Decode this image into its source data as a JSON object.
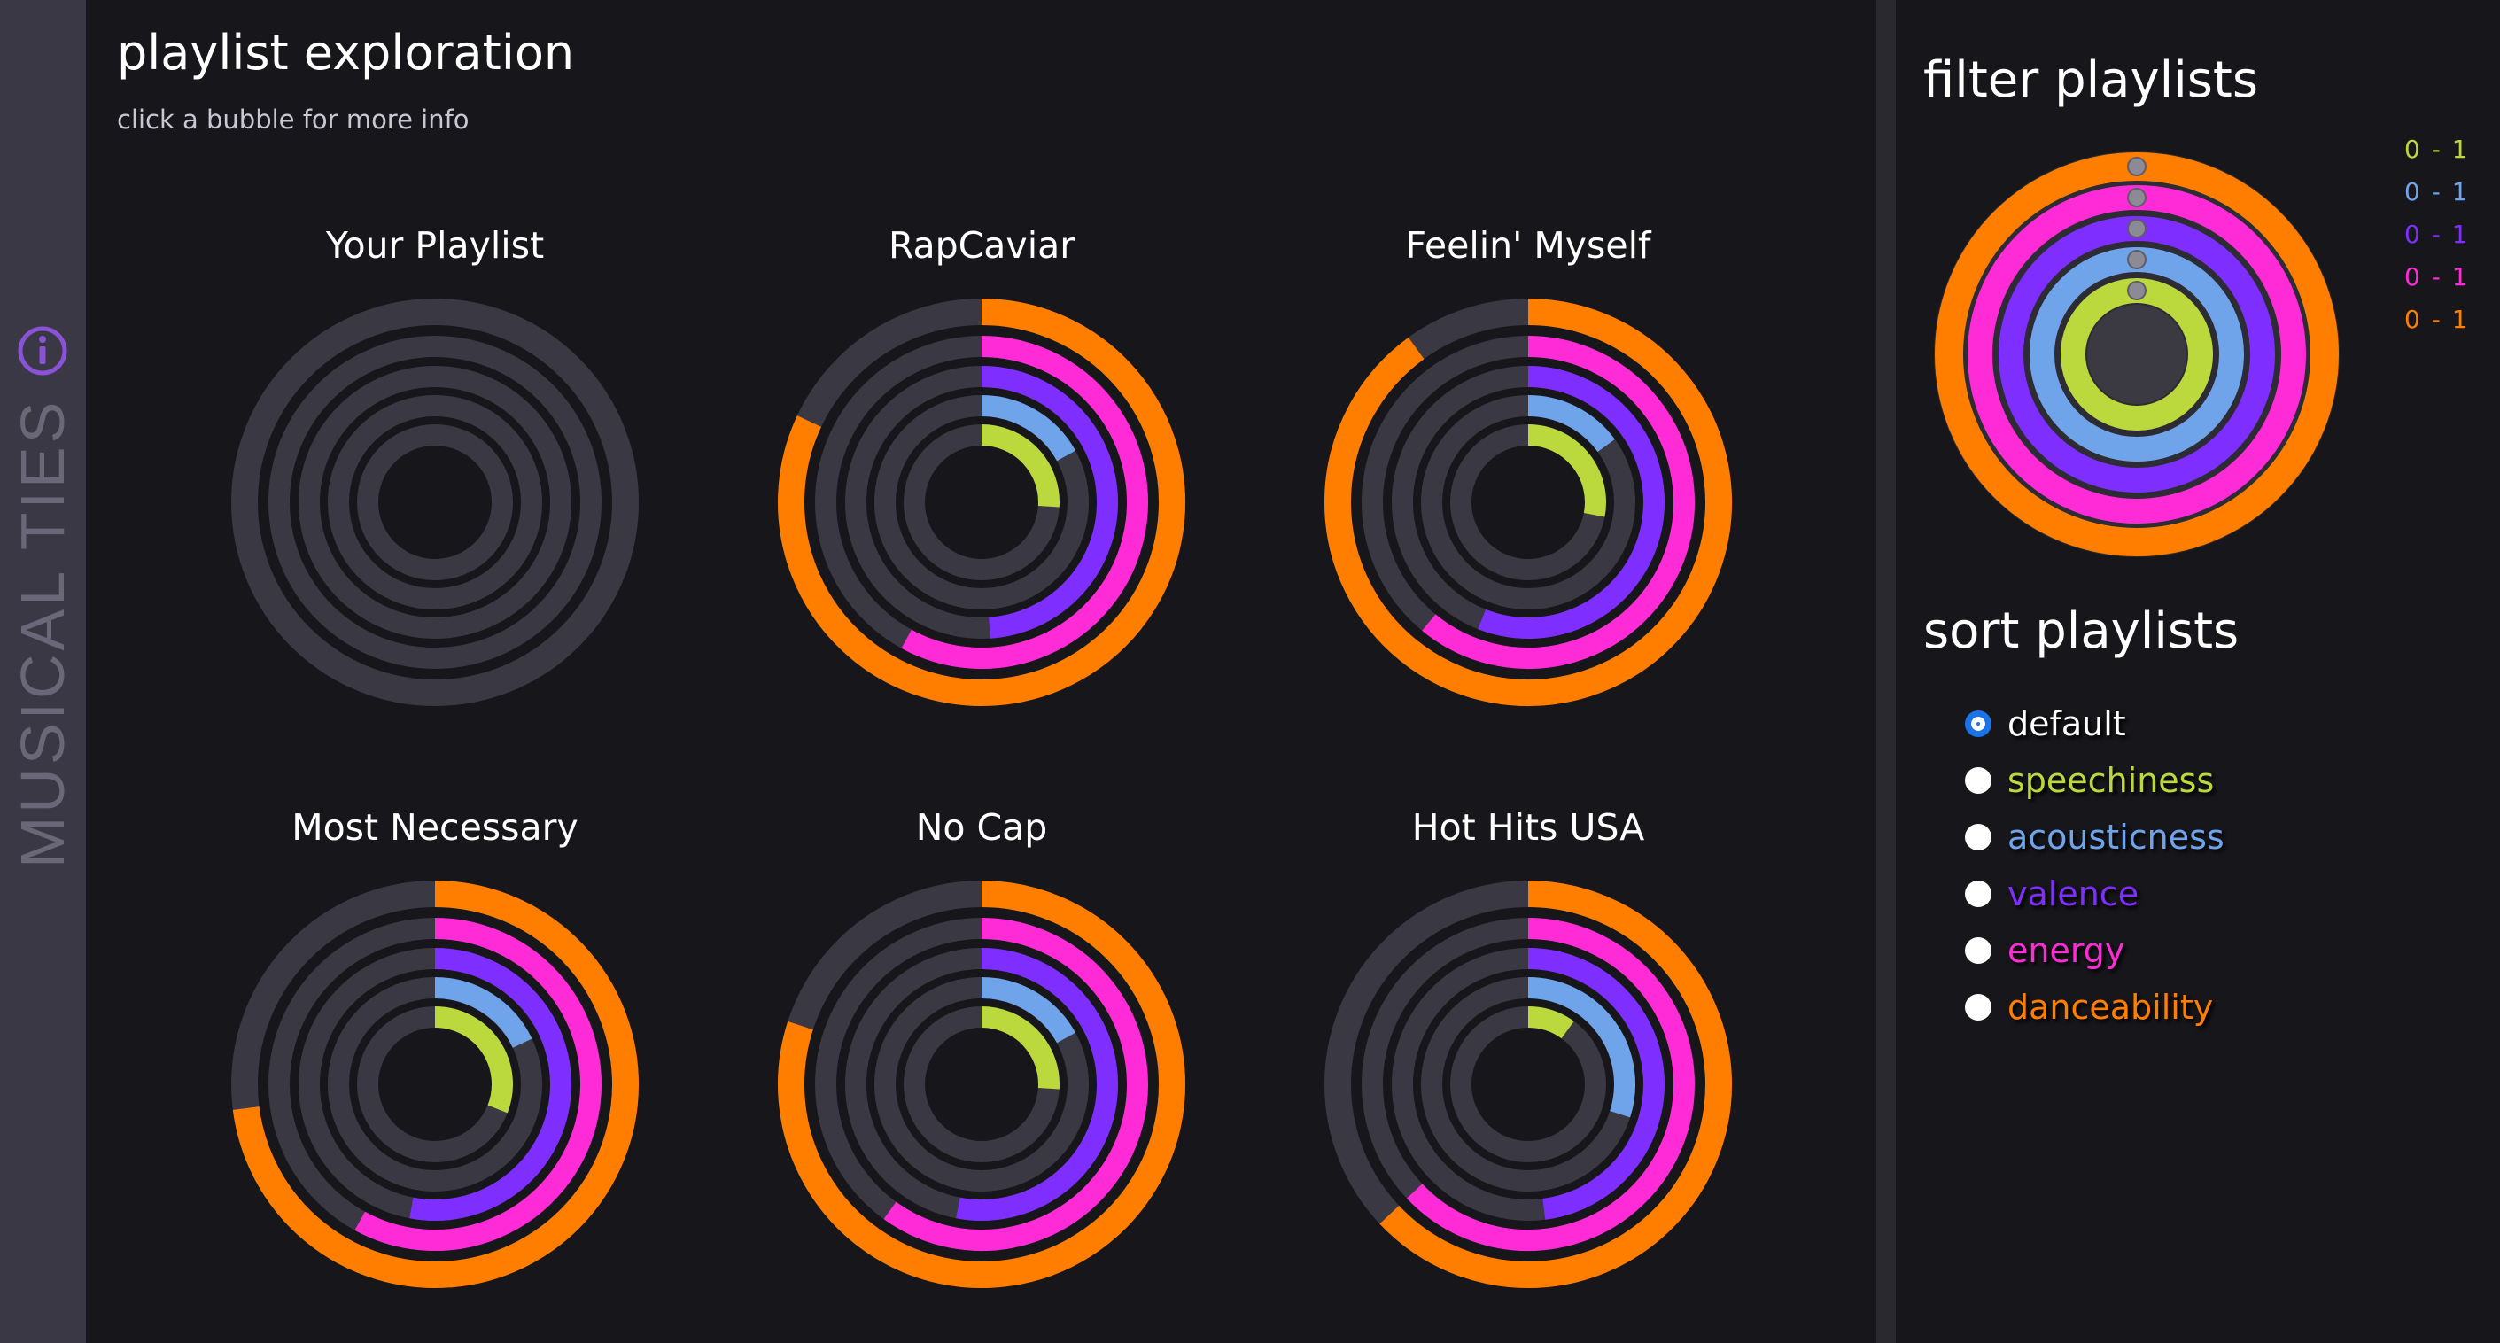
{
  "app": {
    "name": "MUSICAL TIES",
    "info_icon": "info-icon"
  },
  "main": {
    "title": "playlist exploration",
    "subtitle": "click a bubble for more info"
  },
  "colors": {
    "speechiness": "#bbd83c",
    "acousticness": "#6fa4ea",
    "valence": "#7e2fff",
    "energy": "#ff2bd6",
    "danceability": "#ff7e00",
    "track": "#3a3843",
    "accent": "#1a73e8"
  },
  "playlists": [
    {
      "name": "Your Playlist",
      "selected": true,
      "values": {
        "speechiness": 0,
        "acousticness": 0,
        "valence": 0,
        "energy": 0,
        "danceability": 0
      }
    },
    {
      "name": "RapCaviar",
      "selected": false,
      "values": {
        "speechiness": 0.26,
        "acousticness": 0.17,
        "valence": 0.49,
        "energy": 0.58,
        "danceability": 0.82
      }
    },
    {
      "name": "Feelin' Myself",
      "selected": false,
      "values": {
        "speechiness": 0.28,
        "acousticness": 0.15,
        "valence": 0.56,
        "energy": 0.61,
        "danceability": 0.9
      }
    },
    {
      "name": "Most Necessary",
      "selected": false,
      "values": {
        "speechiness": 0.31,
        "acousticness": 0.18,
        "valence": 0.53,
        "energy": 0.58,
        "danceability": 0.73
      }
    },
    {
      "name": "No Cap",
      "selected": false,
      "values": {
        "speechiness": 0.26,
        "acousticness": 0.17,
        "valence": 0.53,
        "energy": 0.6,
        "danceability": 0.8
      }
    },
    {
      "name": "Hot Hits USA",
      "selected": false,
      "values": {
        "speechiness": 0.1,
        "acousticness": 0.3,
        "valence": 0.48,
        "energy": 0.63,
        "danceability": 0.63
      }
    }
  ],
  "filter": {
    "title": "filter playlists",
    "ranges": [
      {
        "feature": "speechiness",
        "label": "0 - 1"
      },
      {
        "feature": "acousticness",
        "label": "0 - 1"
      },
      {
        "feature": "valence",
        "label": "0 - 1"
      },
      {
        "feature": "energy",
        "label": "0 - 1"
      },
      {
        "feature": "danceability",
        "label": "0 - 1"
      }
    ]
  },
  "sort": {
    "title": "sort playlists",
    "selected": "default",
    "options": [
      {
        "key": "default",
        "label": "default",
        "color": "#ffffff"
      },
      {
        "key": "speechiness",
        "label": "speechiness",
        "color": "#bbd83c"
      },
      {
        "key": "acousticness",
        "label": "acousticness",
        "color": "#6fa4ea"
      },
      {
        "key": "valence",
        "label": "valence",
        "color": "#7e2fff"
      },
      {
        "key": "energy",
        "label": "energy",
        "color": "#ff2bd6"
      },
      {
        "key": "danceability",
        "label": "danceability",
        "color": "#ff7e00"
      }
    ]
  }
}
